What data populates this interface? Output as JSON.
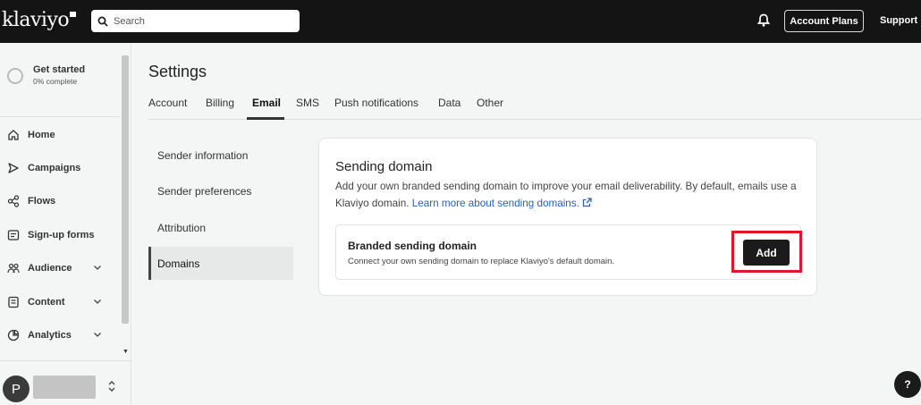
{
  "topbar": {
    "logo": "klaviyo",
    "search_placeholder": "Search",
    "account_plans": "Account Plans",
    "support": "Support"
  },
  "sidebar": {
    "get_started": {
      "title": "Get started",
      "progress_text": "0% complete",
      "progress": 0
    },
    "items": [
      {
        "label": "Home",
        "icon": "home-icon"
      },
      {
        "label": "Campaigns",
        "icon": "send-icon"
      },
      {
        "label": "Flows",
        "icon": "flows-icon"
      },
      {
        "label": "Sign-up forms",
        "icon": "form-icon"
      },
      {
        "label": "Audience",
        "icon": "audience-icon",
        "expandable": true
      },
      {
        "label": "Content",
        "icon": "content-icon",
        "expandable": true
      },
      {
        "label": "Analytics",
        "icon": "analytics-icon",
        "expandable": true
      }
    ],
    "user_initial": "P"
  },
  "page": {
    "title": "Settings",
    "tabs": [
      "Account",
      "Billing",
      "Email",
      "SMS",
      "Push notifications",
      "Data",
      "Other"
    ],
    "active_tab": "Email",
    "subnav": [
      "Sender information",
      "Sender preferences",
      "Attribution",
      "Domains"
    ],
    "active_subnav": "Domains"
  },
  "card": {
    "title": "Sending domain",
    "description": "Add your own branded sending domain to improve your email deliverability. By default, emails use a Klaviyo domain.",
    "link": "Learn more about sending domains.",
    "inner_title": "Branded sending domain",
    "inner_sub": "Connect your own sending domain to replace Klaviyo's default domain.",
    "add_label": "Add"
  },
  "help_label": "?",
  "colors": {
    "topbar": "#141414",
    "link": "#2a62b8",
    "highlight": "#e0152b"
  }
}
